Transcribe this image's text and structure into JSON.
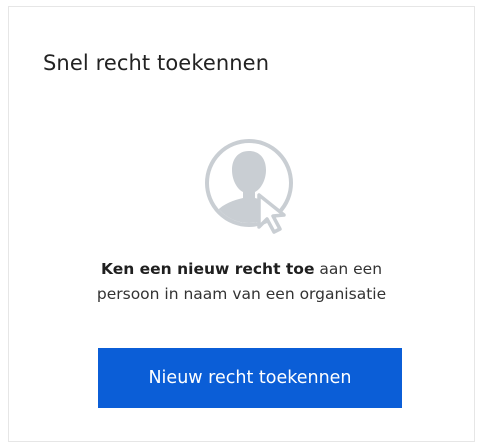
{
  "card": {
    "title": "Snel recht toekennen",
    "illustration_icon": "user-pointer-icon",
    "description": {
      "bold": "Ken een nieuw recht toe",
      "rest_line1": " aan een",
      "line2": "persoon in naam van een organisatie"
    },
    "button_label": "Nieuw recht toekennen"
  },
  "colors": {
    "button_background": "#0b5ed7",
    "button_text": "#ffffff",
    "icon_gray": "#c9ced3",
    "card_border": "#e6e6e6"
  }
}
